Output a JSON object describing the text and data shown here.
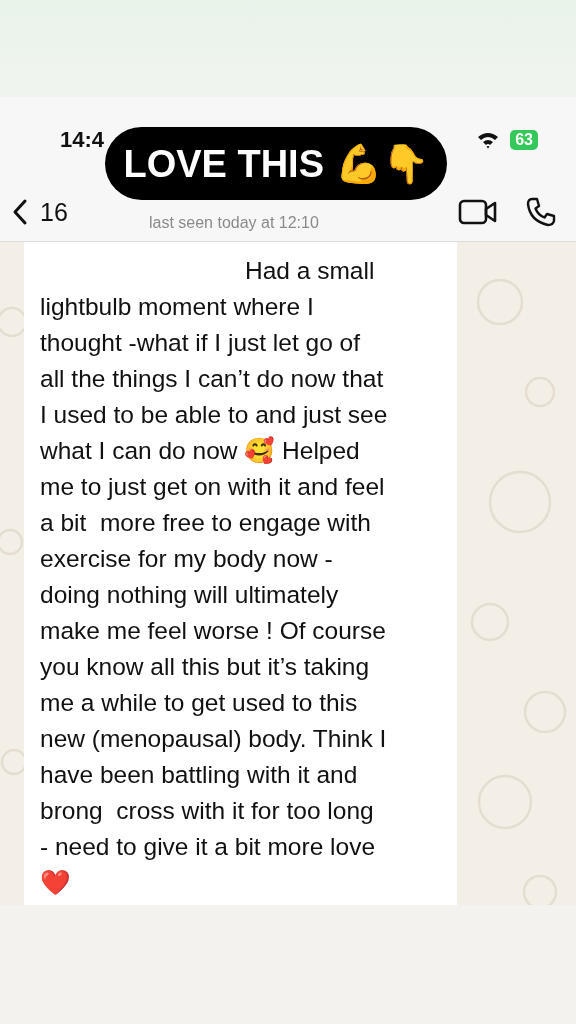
{
  "status_bar": {
    "time": "14:4",
    "battery": "63"
  },
  "header": {
    "back_count": "16",
    "last_seen": "last seen today at 12:10"
  },
  "sticker": {
    "text": "LOVE THIS 💪👇"
  },
  "message": {
    "text": "Had a small\nlightbulb moment where I\nthought -what if I just let go of\nall the things I can’t do now that\nI used to be able to and just see\nwhat I can do now 🥰 Helped\nme to just get on with it and feel\na bit  more free to engage with\nexercise for my body now -\ndoing nothing will ultimately\nmake me feel worse ! Of course\nyou know all this but it’s taking\nme a while to get used to this\nnew (menopausal) body. Think I\nhave been battling with it and\nbrong  cross with it for too long\n- need to give it a bit more love\n❤️"
  }
}
